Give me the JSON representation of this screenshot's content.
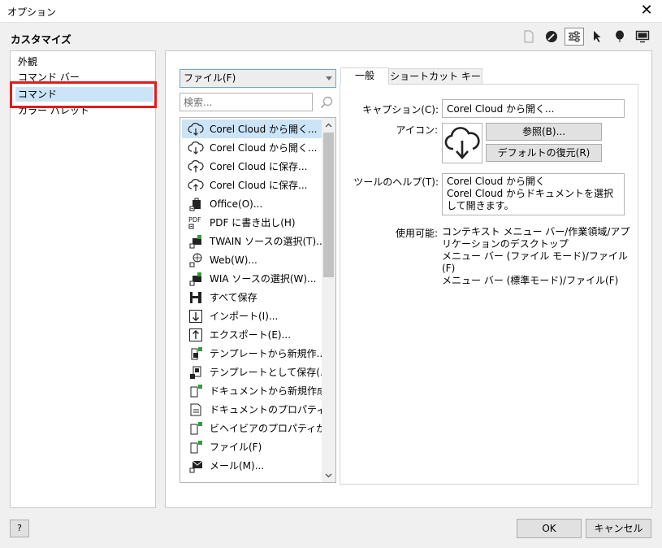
{
  "window": {
    "title": "オプション"
  },
  "header": {
    "section_title": "カスタマイズ"
  },
  "tree": {
    "items": [
      {
        "label": "外観"
      },
      {
        "label": "コマンド バー"
      },
      {
        "label": "コマンド"
      },
      {
        "label": "カラー パレット"
      }
    ]
  },
  "commands": {
    "category": "ファイル(F)",
    "search_placeholder": "検索...",
    "items": [
      {
        "label": "Corel Cloud から開く...",
        "icon": "cloud-open-icon"
      },
      {
        "label": "Corel Cloud から開く...",
        "icon": "cloud-open-icon"
      },
      {
        "label": "Corel Cloud に保存...",
        "icon": "cloud-save-icon"
      },
      {
        "label": "Corel Cloud に保存...",
        "icon": "cloud-save-icon"
      },
      {
        "label": "Office(O)...",
        "icon": "office-icon"
      },
      {
        "label": "PDF に書き出し(H)",
        "icon": "pdf-icon"
      },
      {
        "label": "TWAIN ソースの選択(T)...",
        "icon": "twain-icon"
      },
      {
        "label": "Web(W)...",
        "icon": "web-icon"
      },
      {
        "label": "WIA ソースの選択(W)...",
        "icon": "wia-icon"
      },
      {
        "label": "すべて保存",
        "icon": "save-all-icon"
      },
      {
        "label": "インポート(I)...",
        "icon": "import-icon"
      },
      {
        "label": "エクスポート(E)...",
        "icon": "export-icon"
      },
      {
        "label": "テンプレートから新規作...",
        "icon": "new-from-template-icon"
      },
      {
        "label": "テンプレートとして保存(...",
        "icon": "save-as-template-icon"
      },
      {
        "label": "ドキュメントから新規作成",
        "icon": "new-from-document-icon"
      },
      {
        "label": "ドキュメントのプロパティ(P...",
        "icon": "document-properties-icon"
      },
      {
        "label": "ビヘイビアのプロパティが...",
        "icon": "behavior-properties-icon"
      },
      {
        "label": "ファイル(F)",
        "icon": "new-file-icon"
      },
      {
        "label": "メール(M)...",
        "icon": "mail-icon"
      }
    ]
  },
  "tabs": [
    {
      "label": "一般"
    },
    {
      "label": "ショートカット キー"
    }
  ],
  "general": {
    "caption_label": "キャプション(C):",
    "caption_value": "Corel Cloud から開く...",
    "icon_label": "アイコン:",
    "browse_button": "参照(B)...",
    "restore_default_button": "デフォルトの復元(R)",
    "tooltip_label": "ツールのヘルプ(T):",
    "tooltip_value": "Corel Cloud から開く\nCorel Cloud からドキュメントを選択して開きます。",
    "available_label": "使用可能:",
    "available_value": "コンテキスト メニュー バー/作業領域/アプリケーションのデスクトップ\nメニュー バー (ファイル モード)/ファイル(F)\nメニュー バー (標準モード)/ファイル(F)"
  },
  "footer": {
    "help_label": "?",
    "ok_label": "OK",
    "cancel_label": "キャンセル"
  }
}
